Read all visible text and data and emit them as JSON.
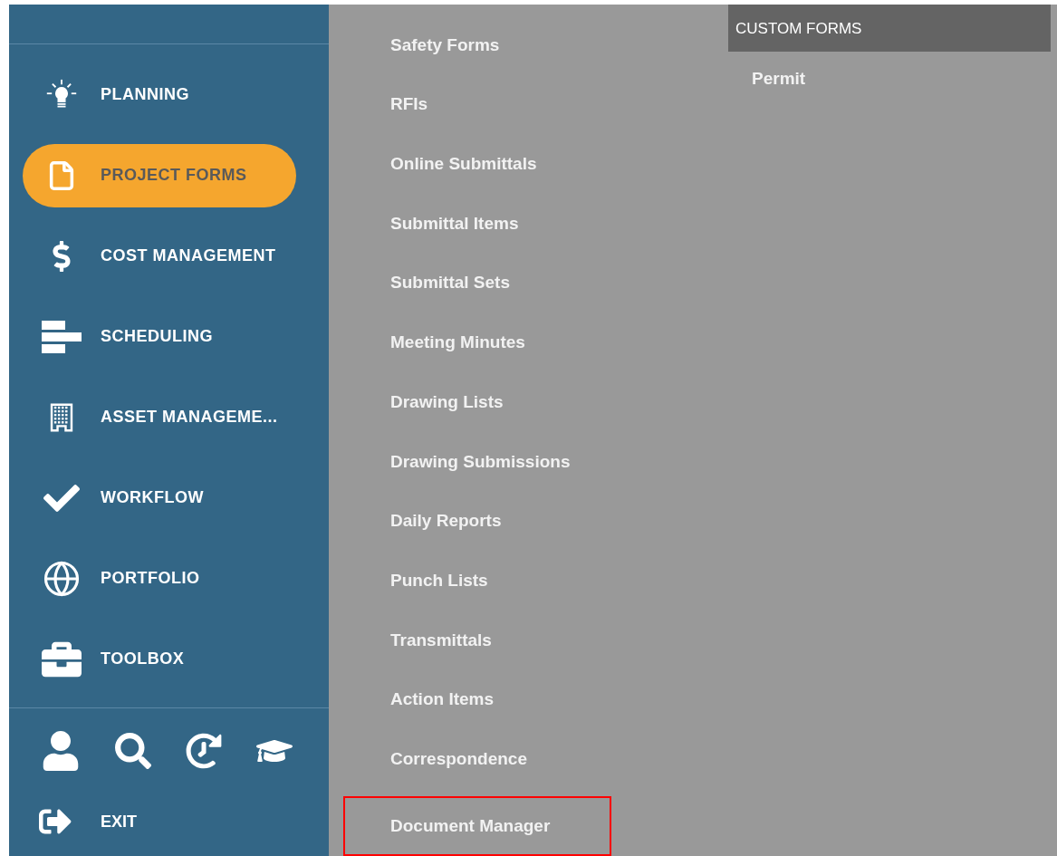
{
  "sidebar": {
    "items": [
      {
        "label": "PLANNING",
        "selected": false
      },
      {
        "label": "PROJECT FORMS",
        "selected": true
      },
      {
        "label": "COST MANAGEMENT",
        "selected": false
      },
      {
        "label": "SCHEDULING",
        "selected": false
      },
      {
        "label": "ASSET MANAGEME...",
        "selected": false
      },
      {
        "label": "WORKFLOW",
        "selected": false
      },
      {
        "label": "PORTFOLIO",
        "selected": false
      },
      {
        "label": "TOOLBOX",
        "selected": false
      }
    ],
    "exit": {
      "label": "EXIT"
    }
  },
  "forms_menu": {
    "items": [
      {
        "label": "Safety Forms",
        "highlighted": false
      },
      {
        "label": "RFIs",
        "highlighted": false
      },
      {
        "label": "Online Submittals",
        "highlighted": false
      },
      {
        "label": "Submittal Items",
        "highlighted": false
      },
      {
        "label": "Submittal Sets",
        "highlighted": false
      },
      {
        "label": "Meeting Minutes",
        "highlighted": false
      },
      {
        "label": "Drawing Lists",
        "highlighted": false
      },
      {
        "label": "Drawing Submissions",
        "highlighted": false
      },
      {
        "label": "Daily Reports",
        "highlighted": false
      },
      {
        "label": "Punch Lists",
        "highlighted": false
      },
      {
        "label": "Transmittals",
        "highlighted": false
      },
      {
        "label": "Action Items",
        "highlighted": false
      },
      {
        "label": "Correspondence",
        "highlighted": false
      },
      {
        "label": "Document Manager",
        "highlighted": true
      }
    ]
  },
  "custom_forms": {
    "title": "CUSTOM FORMS",
    "items": [
      {
        "label": "Permit"
      }
    ]
  }
}
